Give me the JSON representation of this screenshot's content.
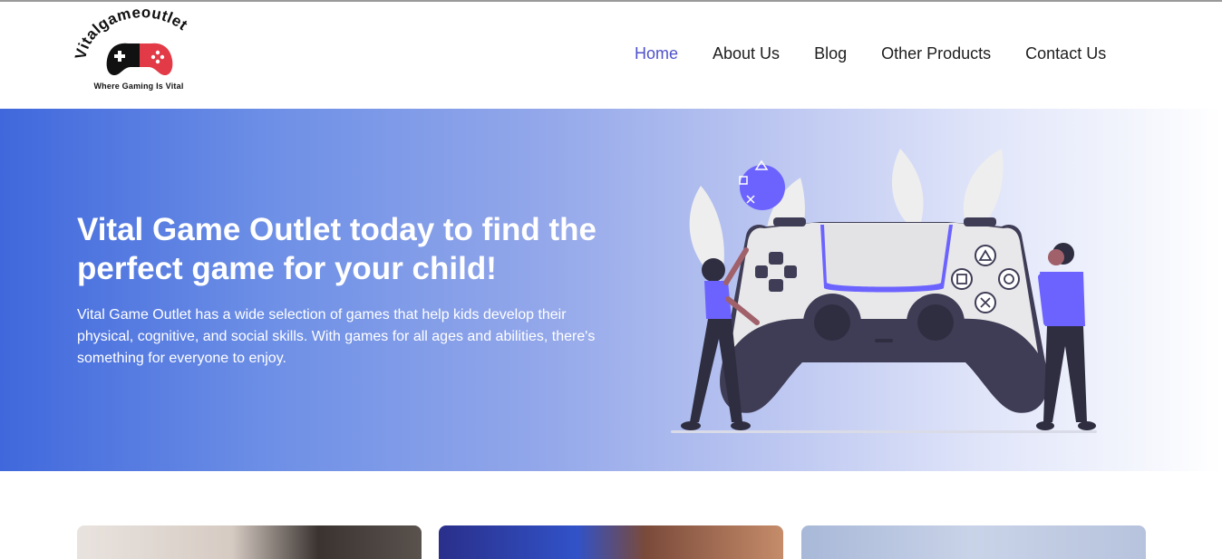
{
  "logo": {
    "text": "Vitalgameoutlet",
    "tagline": "Where Gaming Is Vital"
  },
  "nav": {
    "items": [
      {
        "label": "Home",
        "active": true
      },
      {
        "label": "About Us",
        "active": false
      },
      {
        "label": "Blog",
        "active": false
      },
      {
        "label": "Other Products",
        "active": false
      },
      {
        "label": "Contact Us",
        "active": false
      }
    ]
  },
  "hero": {
    "title": "Vital Game Outlet today to find the perfect game for your child!",
    "description": "Vital Game Outlet has a wide selection of games that help kids develop their physical, cognitive, and social skills. With games for all ages and abilities, there's something for everyone to enjoy."
  },
  "colors": {
    "accent": "#4f52c9",
    "hero_gradient_start": "#4068dc",
    "illustration_purple": "#6c63ff"
  }
}
